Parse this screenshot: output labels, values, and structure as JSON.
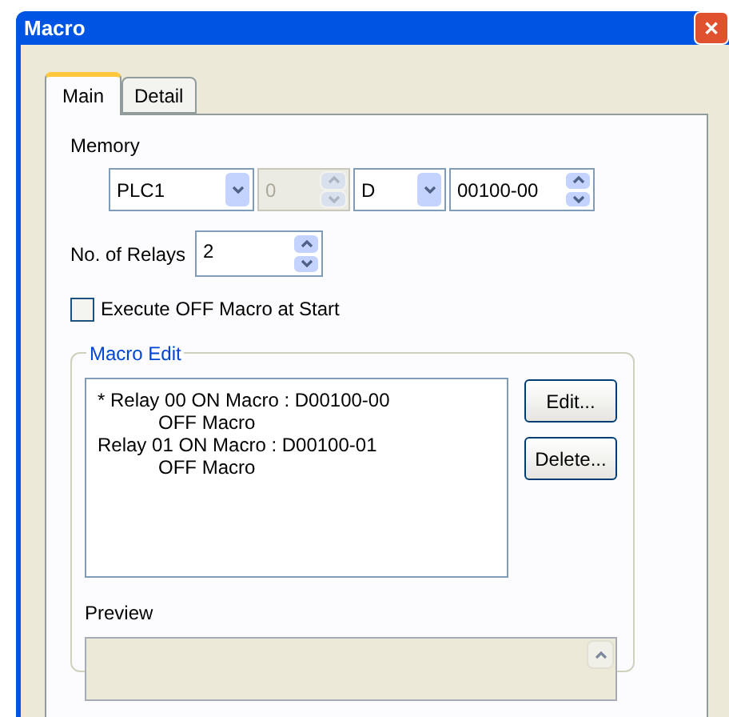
{
  "window": {
    "title": "Macro",
    "close": "✕"
  },
  "tabs": [
    {
      "label": "Main",
      "selected": true
    },
    {
      "label": "Detail",
      "selected": false
    }
  ],
  "memory": {
    "label": "Memory",
    "plc": "PLC1",
    "station": "0",
    "station_disabled": true,
    "device": "D",
    "address": "00100-00"
  },
  "relays": {
    "label": "No. of Relays",
    "value": "2"
  },
  "execute_off": {
    "label": "Execute OFF Macro at Start",
    "checked": false
  },
  "macro_edit": {
    "title": "Macro Edit",
    "lines": [
      {
        "text": "* Relay 00 ON Macro : D00100-00",
        "indent": false
      },
      {
        "text": "OFF Macro",
        "indent": true
      },
      {
        "text": "Relay 01 ON Macro : D00100-01",
        "indent": false
      },
      {
        "text": "OFF Macro",
        "indent": true
      }
    ],
    "buttons": [
      "Edit...",
      "Delete..."
    ]
  },
  "preview": {
    "label": "Preview"
  }
}
